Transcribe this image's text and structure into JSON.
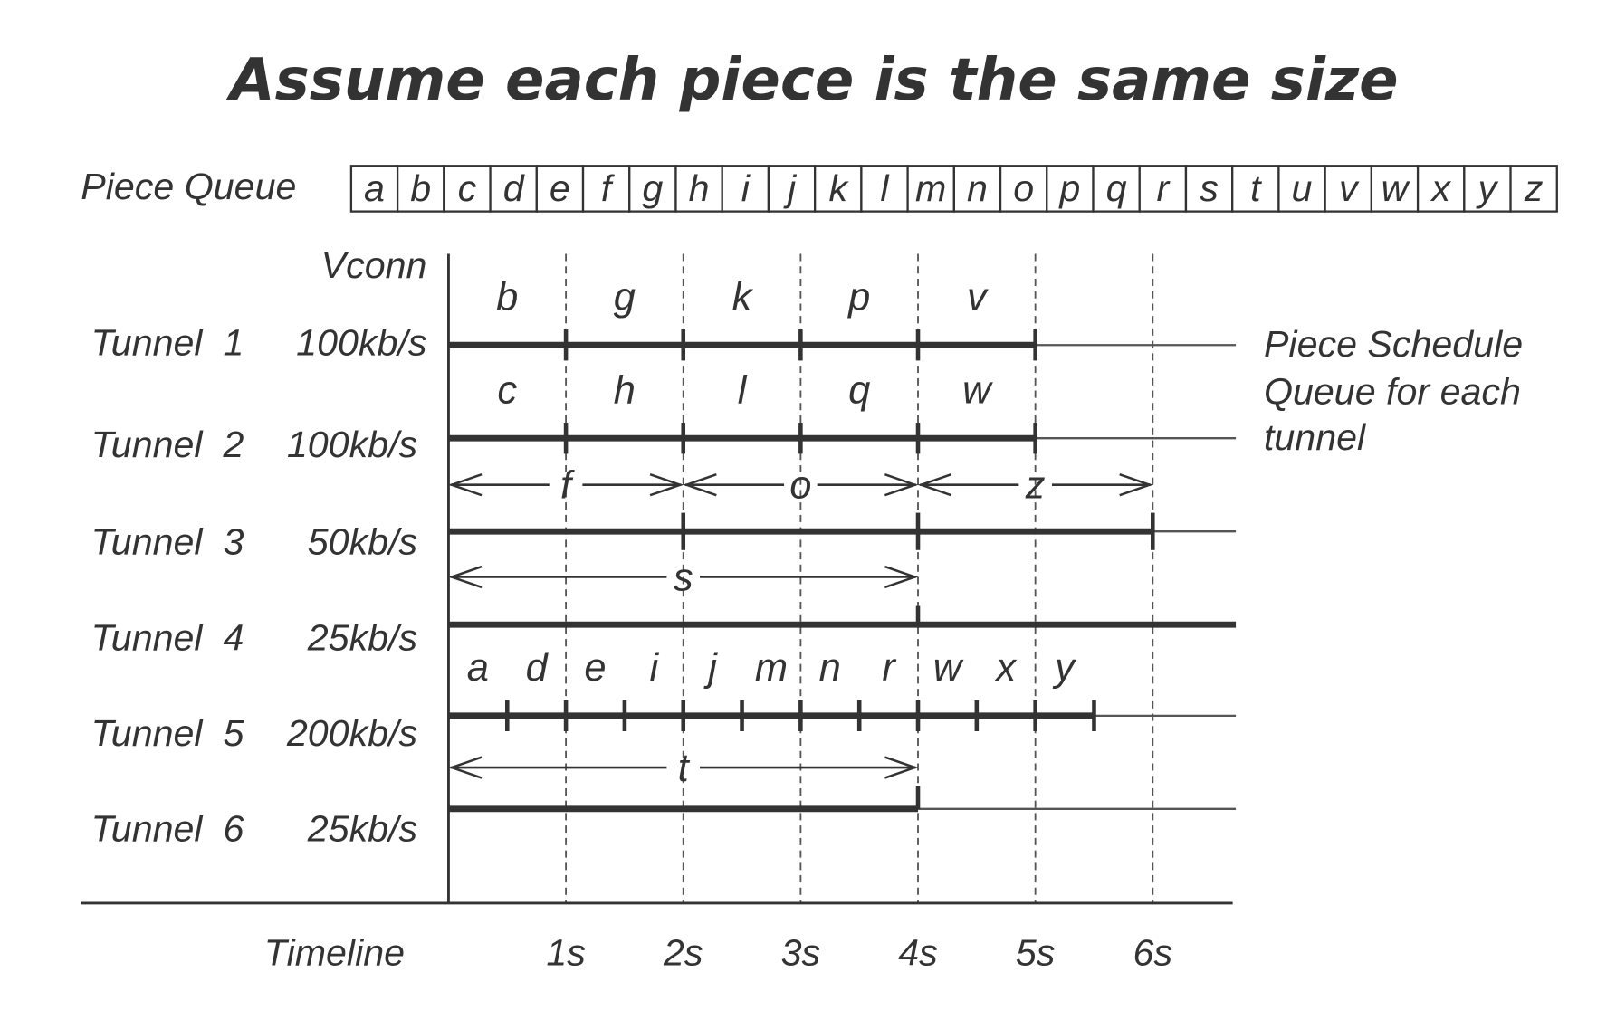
{
  "title": "Assume each piece is the same size",
  "piece_queue": {
    "label": "Piece Queue",
    "pieces": [
      "a",
      "b",
      "c",
      "d",
      "e",
      "f",
      "g",
      "h",
      "i",
      "j",
      "k",
      "l",
      "m",
      "n",
      "o",
      "p",
      "q",
      "r",
      "s",
      "t",
      "u",
      "v",
      "w",
      "x",
      "y",
      "z"
    ]
  },
  "vconn_label": "Vconn",
  "timeline": {
    "label": "Timeline",
    "ticks": [
      "1s",
      "2s",
      "3s",
      "4s",
      "5s",
      "6s"
    ],
    "max_seconds": 6
  },
  "side_note": [
    "Piece Schedule",
    "Queue for each",
    "tunnel"
  ],
  "tunnels": [
    {
      "name": "Tunnel  1",
      "rate": "100kb/s",
      "piece_seconds": 1,
      "pieces": [
        "b",
        "g",
        "k",
        "p",
        "v"
      ],
      "style": "labels"
    },
    {
      "name": "Tunnel  2",
      "rate": "100kb/s",
      "piece_seconds": 1,
      "pieces": [
        "c",
        "h",
        "l",
        "q",
        "w"
      ],
      "style": "labels"
    },
    {
      "name": "Tunnel  3",
      "rate": "50kb/s",
      "piece_seconds": 2,
      "pieces": [
        "f",
        "o",
        "z"
      ],
      "style": "arrows"
    },
    {
      "name": "Tunnel  4",
      "rate": "25kb/s",
      "piece_seconds": 4,
      "pieces": [
        "s"
      ],
      "style": "arrows"
    },
    {
      "name": "Tunnel  5",
      "rate": "200kb/s",
      "piece_seconds": 0.5,
      "pieces": [
        "a",
        "d",
        "e",
        "i",
        "j",
        "m",
        "n",
        "r",
        "w",
        "x",
        "y"
      ],
      "style": "labels"
    },
    {
      "name": "Tunnel  6",
      "rate": "25kb/s",
      "piece_seconds": 4,
      "pieces": [
        "t"
      ],
      "style": "arrows"
    }
  ]
}
